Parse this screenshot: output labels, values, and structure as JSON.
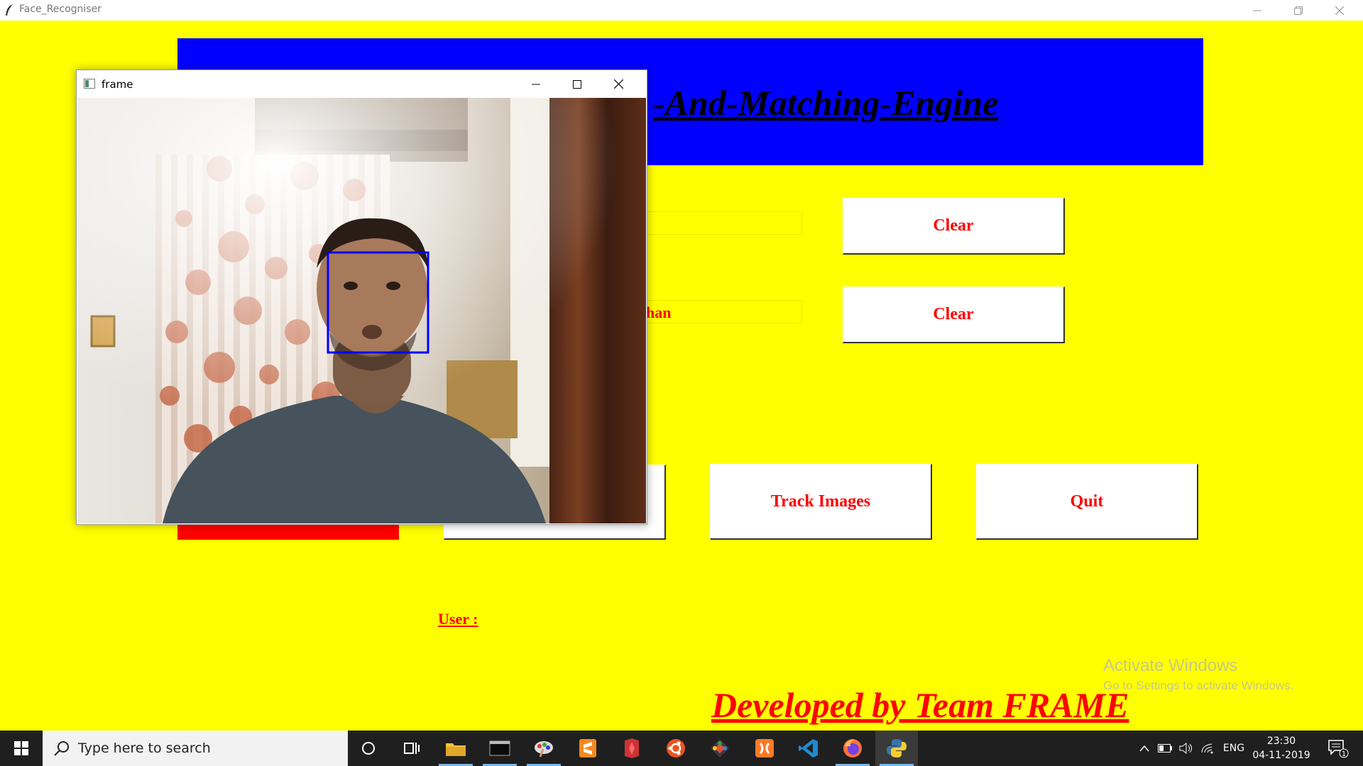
{
  "window": {
    "title": "Face_Recogniser"
  },
  "app": {
    "banner_title": "-And-Matching-Engine",
    "entry_2_value": "han",
    "clear_label_1": "Clear",
    "clear_label_2": "Clear",
    "track_label": "Track Images",
    "quit_label": "Quit",
    "user_label": "User : ",
    "credit": "Developed by Team FRAME"
  },
  "frame_window": {
    "title": "frame",
    "content": "webcam feed with blue face detection rectangle"
  },
  "watermark": {
    "line1": "Activate Windows",
    "line2": "Go to Settings to activate Windows."
  },
  "taskbar": {
    "search_placeholder": "Type here to search",
    "apps": [
      "cortana-icon",
      "task-view-icon",
      "file-explorer-icon",
      "terminal-icon",
      "paint-icon",
      "sublime-text-icon",
      "git-kraken-icon",
      "ubuntu-icon",
      "git-icon",
      "xampp-icon",
      "vscode-icon",
      "firefox-icon",
      "python-icon"
    ],
    "lang": "ENG",
    "time": "23:30",
    "date": "04-11-2019",
    "notification_count": "1"
  },
  "colors": {
    "background": "#ffff00",
    "banner": "#0000ff",
    "accent_text": "#ff0000",
    "face_box": "#0000ff"
  }
}
